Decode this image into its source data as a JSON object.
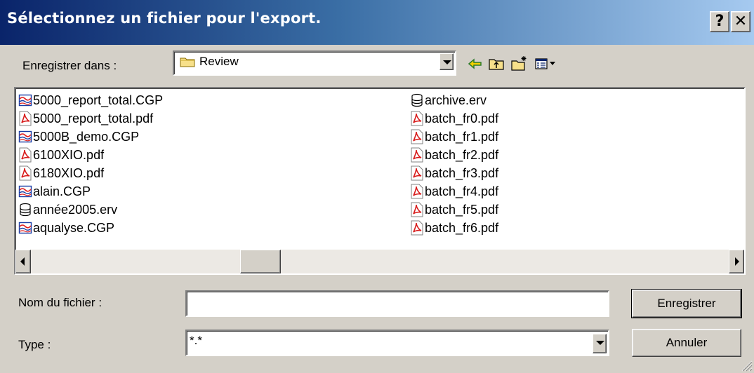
{
  "window": {
    "title": "Sélectionnez un fichier pour l'export.",
    "help_label": "?",
    "close_label": "✕"
  },
  "save_in": {
    "label": "Enregistrer dans :",
    "value": "Review"
  },
  "toolbar": {
    "back_icon": "back-arrow-icon",
    "up_icon": "up-folder-icon",
    "new_folder_icon": "new-folder-icon",
    "view_menu_icon": "view-menu-icon"
  },
  "files": {
    "column1": [
      {
        "name": "5000_report_total.CGP",
        "icon": "cgp-icon"
      },
      {
        "name": "5000_report_total.pdf",
        "icon": "pdf-icon"
      },
      {
        "name": "5000B_demo.CGP",
        "icon": "cgp-icon"
      },
      {
        "name": "6100XIO.pdf",
        "icon": "pdf-icon"
      },
      {
        "name": "6180XIO.pdf",
        "icon": "pdf-icon"
      },
      {
        "name": "alain.CGP",
        "icon": "cgp-icon"
      },
      {
        "name": "année2005.erv",
        "icon": "database-icon"
      },
      {
        "name": "aqualyse.CGP",
        "icon": "cgp-icon"
      }
    ],
    "column2": [
      {
        "name": "archive.erv",
        "icon": "database-icon"
      },
      {
        "name": "batch_fr0.pdf",
        "icon": "pdf-icon"
      },
      {
        "name": "batch_fr1.pdf",
        "icon": "pdf-icon"
      },
      {
        "name": "batch_fr2.pdf",
        "icon": "pdf-icon"
      },
      {
        "name": "batch_fr3.pdf",
        "icon": "pdf-icon"
      },
      {
        "name": "batch_fr4.pdf",
        "icon": "pdf-icon"
      },
      {
        "name": "batch_fr5.pdf",
        "icon": "pdf-icon"
      },
      {
        "name": "batch_fr6.pdf",
        "icon": "pdf-icon"
      }
    ]
  },
  "filename": {
    "label": "Nom du fichier :",
    "value": ""
  },
  "type": {
    "label": "Type :",
    "value": "*.*"
  },
  "buttons": {
    "save": "Enregistrer",
    "cancel": "Annuler"
  }
}
